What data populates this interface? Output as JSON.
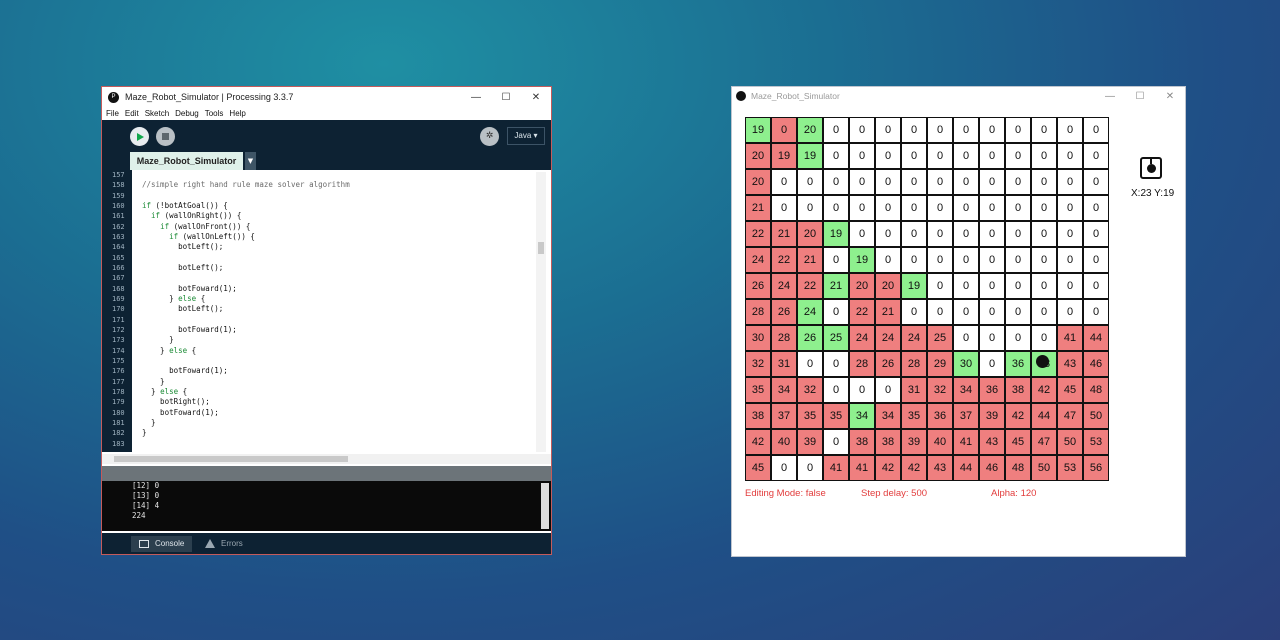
{
  "ide": {
    "title": "Maze_Robot_Simulator | Processing 3.3.7",
    "window_controls": [
      "—",
      "☐",
      "✕"
    ],
    "menu": [
      "File",
      "Edit",
      "Sketch",
      "Debug",
      "Tools",
      "Help"
    ],
    "mode": "Java ▾",
    "debug_icon": "butterfly-icon",
    "tab_name": "Maze_Robot_Simulator",
    "line_numbers": [
      "157",
      "158",
      "159",
      "160",
      "161",
      "162",
      "163",
      "164",
      "165",
      "166",
      "167",
      "168",
      "169",
      "170",
      "171",
      "172",
      "173",
      "174",
      "175",
      "176",
      "177",
      "178",
      "179",
      "180",
      "181",
      "182",
      "183"
    ],
    "code": [
      "",
      "//simple right hand rule maze solver algorithm",
      "",
      "if (!botAtGoal()) {",
      "  if (wallOnRight()) {",
      "    if (wallOnFront()) {",
      "      if (wallOnLeft()) {",
      "        botLeft();",
      "",
      "        botLeft();",
      "",
      "        botFoward(1);",
      "      } else {",
      "        botLeft();",
      "",
      "        botFoward(1);",
      "      }",
      "    } else {",
      "",
      "      botFoward(1);",
      "    }",
      "  } else {",
      "    botRight();",
      "    botFoward(1);",
      "  }",
      "}",
      ""
    ],
    "console_lines": [
      "[12] 0",
      "[13] 0",
      "[14] 4",
      "224"
    ],
    "console_tab": "Console",
    "errors_tab": "Errors"
  },
  "sketch": {
    "title": "Maze_Robot_Simulator",
    "window_controls": [
      "—",
      "☐",
      "✕"
    ],
    "coords": "X:23 Y:19",
    "editing_mode": "Editing Mode: false",
    "step_delay": "Step delay: 500",
    "alpha": "Alpha: 120",
    "colors": {
      "red": "#ef7f7f",
      "green": "#8ef08e",
      "white": "#ffffff",
      "text_red": "#e23c3c"
    },
    "rows": [
      [
        "G19",
        "R0",
        "G20",
        "W0",
        "W0",
        "W0",
        "W0",
        "W0",
        "W0",
        "W0",
        "W0",
        "W0",
        "W0",
        "W0"
      ],
      [
        "R20",
        "R19",
        "G19",
        "W0",
        "W0",
        "W0",
        "W0",
        "W0",
        "W0",
        "W0",
        "W0",
        "W0",
        "W0",
        "W0"
      ],
      [
        "R20",
        "W0",
        "W0",
        "W0",
        "W0",
        "W0",
        "W0",
        "W0",
        "W0",
        "W0",
        "W0",
        "W0",
        "W0",
        "W0"
      ],
      [
        "R21",
        "W0",
        "W0",
        "W0",
        "W0",
        "W0",
        "W0",
        "W0",
        "W0",
        "W0",
        "W0",
        "W0",
        "W0",
        "W0"
      ],
      [
        "R22",
        "R21",
        "R20",
        "G19",
        "W0",
        "W0",
        "W0",
        "W0",
        "W0",
        "W0",
        "W0",
        "W0",
        "W0",
        "W0"
      ],
      [
        "R24",
        "R22",
        "R21",
        "W0",
        "G19",
        "W0",
        "W0",
        "W0",
        "W0",
        "W0",
        "W0",
        "W0",
        "W0",
        "W0"
      ],
      [
        "R26",
        "R24",
        "R22",
        "G21",
        "R20",
        "R20",
        "G19",
        "W0",
        "W0",
        "W0",
        "W0",
        "W0",
        "W0",
        "W0"
      ],
      [
        "R28",
        "R26",
        "G24",
        "W0",
        "R22",
        "R21",
        "W0",
        "W0",
        "W0",
        "W0",
        "W0",
        "W0",
        "W0",
        "W0"
      ],
      [
        "R30",
        "R28",
        "G26",
        "G25",
        "R24",
        "R24",
        "R24",
        "R25",
        "W0",
        "W0",
        "W0",
        "W0",
        "R41",
        "R44"
      ],
      [
        "R32",
        "R31",
        "W0",
        "W0",
        "R28",
        "R26",
        "R28",
        "R29",
        "G30",
        "W0",
        "G36",
        "G38",
        "R43",
        "R46"
      ],
      [
        "R35",
        "R34",
        "R32",
        "W0",
        "W0",
        "W0",
        "R31",
        "R32",
        "R34",
        "R36",
        "R38",
        "R42",
        "R45",
        "R48"
      ],
      [
        "R38",
        "R37",
        "R35",
        "R35",
        "G34",
        "R34",
        "R35",
        "R36",
        "R37",
        "R39",
        "R42",
        "R44",
        "R47",
        "R50"
      ],
      [
        "R42",
        "R40",
        "R39",
        "W0",
        "R38",
        "R38",
        "R39",
        "R40",
        "R41",
        "R43",
        "R45",
        "R47",
        "R50",
        "R53"
      ],
      [
        "R45",
        "W0",
        "W0",
        "R41",
        "R41",
        "R42",
        "R42",
        "R43",
        "R44",
        "R46",
        "R48",
        "R50",
        "R53",
        "R56"
      ]
    ]
  }
}
